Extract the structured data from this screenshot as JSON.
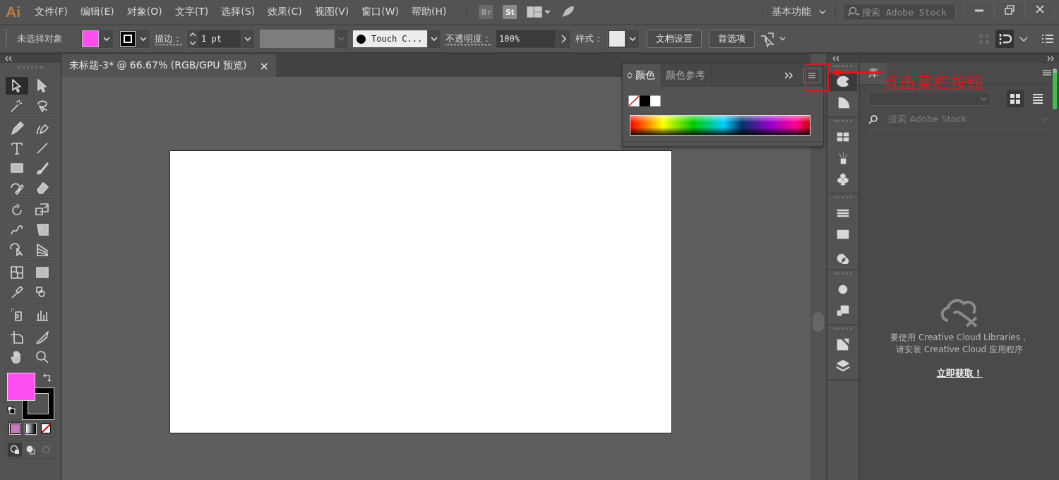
{
  "app_logo": "Ai",
  "menu": [
    "文件(F)",
    "编辑(E)",
    "对象(O)",
    "文字(T)",
    "选择(S)",
    "效果(C)",
    "视图(V)",
    "窗口(W)",
    "帮助(H)"
  ],
  "app_switchers": [
    "Br",
    "St"
  ],
  "workspace": "基本功能",
  "stock_search": {
    "placeholder": "搜索 Adobe Stock"
  },
  "control_bar": {
    "selection": "未选择对象",
    "stroke_label": "描边：",
    "stroke_weight": "1 pt",
    "brush": "Touch C...",
    "opacity_label": "不透明度：",
    "opacity": "100%",
    "style_label": "样式：",
    "buttons": [
      "文档设置",
      "首选项"
    ]
  },
  "document_tab": {
    "title": "未标题-3* @ 66.67% (RGB/GPU 预览)",
    "close": "×"
  },
  "tools": [
    {
      "selected": true
    },
    {
      "selected": false
    },
    {
      "selected": false
    },
    {
      "selected": false
    },
    {
      "selected": false
    },
    {
      "selected": false
    },
    {
      "selected": false
    },
    {
      "selected": false
    },
    {
      "selected": false
    },
    {
      "selected": false
    },
    {
      "selected": false
    },
    {
      "selected": false
    },
    {
      "selected": false
    },
    {
      "selected": false
    },
    {
      "selected": false
    },
    {
      "selected": false
    },
    {
      "selected": false
    },
    {
      "selected": false
    },
    {
      "selected": false
    },
    {
      "selected": false
    },
    {
      "selected": false
    },
    {
      "selected": false
    },
    {
      "selected": false
    },
    {
      "selected": false
    },
    {
      "selected": false
    },
    {
      "selected": false
    },
    {
      "selected": false
    },
    {
      "selected": false
    }
  ],
  "color_panel": {
    "tabs": [
      {
        "label": "颜色",
        "selected": true
      },
      {
        "label": "颜色参考",
        "selected": false
      }
    ]
  },
  "annotation": "点击菜栏按钮",
  "library_panel": {
    "tab": "库",
    "search": {
      "placeholder": "搜索 Adobe Stock"
    },
    "message": [
      "要使用 Creative Cloud Libraries，",
      "请安装 Creative Cloud 应用程序"
    ],
    "link": "立即获取！"
  }
}
